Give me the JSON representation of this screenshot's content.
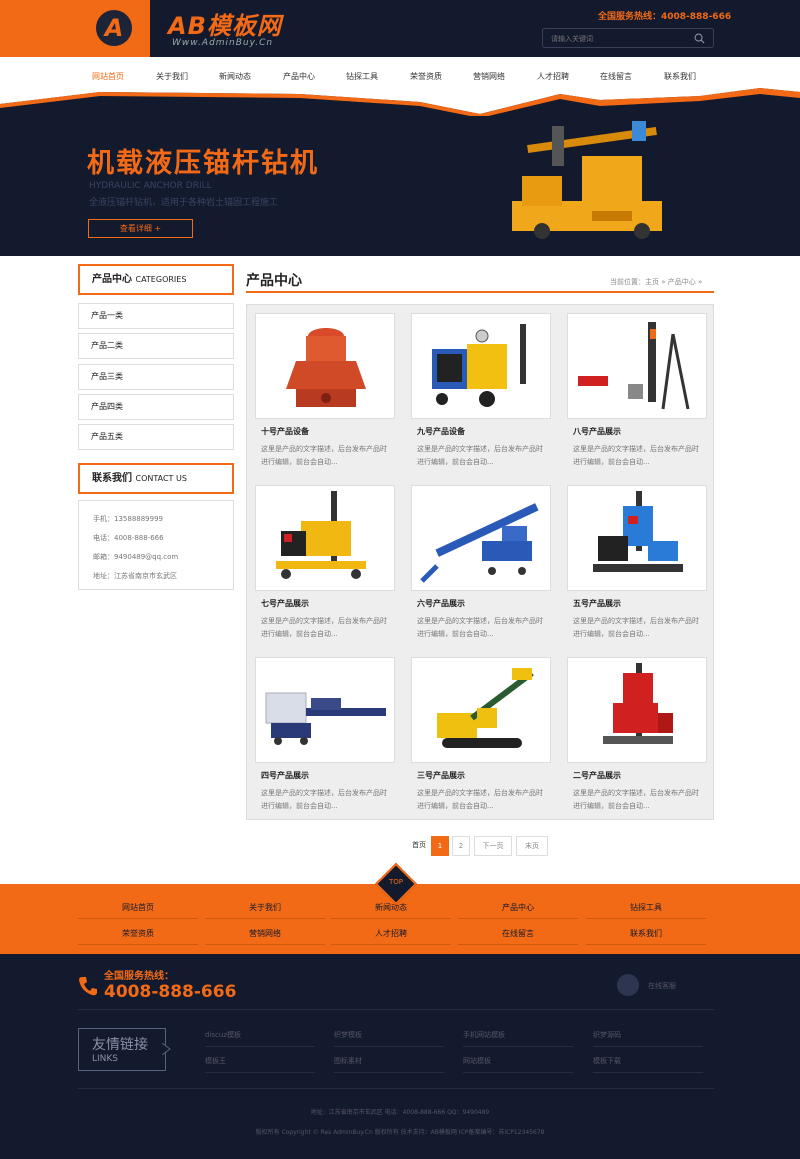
{
  "header": {
    "logo_letter": "A",
    "logo_text": "AB模板网",
    "logo_sub": "Www.AdminBuy.Cn",
    "hotline": "全国服务热线：4008-888-666",
    "search_placeholder": "请输入关键词"
  },
  "nav": {
    "items": [
      "网站首页",
      "关于我们",
      "新闻动态",
      "产品中心",
      "钻探工具",
      "荣誉资质",
      "营销网络",
      "人才招聘",
      "在线留言",
      "联系我们"
    ],
    "active_index": 0
  },
  "banner": {
    "title": "机载液压锚杆钻机",
    "sub1": "HYDRAULIC ANCHOR DRILL",
    "sub2": "全液压锚杆钻机，适用于各种岩土锚固工程施工",
    "button": "查看详细 +"
  },
  "sidebar": {
    "products_head": "产品中心",
    "products_head_en": "CATEGORIES",
    "categories": [
      "产品一类",
      "产品二类",
      "产品三类",
      "产品四类",
      "产品五类"
    ],
    "contact_head": "联系我们",
    "contact_head_en": "CONTACT US",
    "contact": {
      "mobile": "手机：13588889999",
      "phone": "电话：4008-888-666",
      "email": "邮箱：9490489@qq.com",
      "address": "地址：江苏省南京市玄武区"
    }
  },
  "main": {
    "title": "产品中心",
    "breadcrumb": "当前位置：主页 » 产品中心 »",
    "products": [
      {
        "title": "十号产品设备",
        "desc": "这里是产品的文字描述，后台发布产品时进行编辑，前台会自动...",
        "icon": "cone-crusher"
      },
      {
        "title": "九号产品设备",
        "desc": "这里是产品的文字描述，后台发布产品时进行编辑，前台会自动...",
        "icon": "hydraulic-power-unit"
      },
      {
        "title": "八号产品展示",
        "desc": "这里是产品的文字描述，后台发布产品时进行编辑，前台会自动...",
        "icon": "rock-drill-tripod"
      },
      {
        "title": "七号产品展示",
        "desc": "这里是产品的文字描述，后台发布产品时进行编辑，前台会自动...",
        "icon": "core-drill-rig-yellow"
      },
      {
        "title": "六号产品展示",
        "desc": "这里是产品的文字描述，后台发布产品时进行编辑，前台会自动...",
        "icon": "anchor-drill-blue"
      },
      {
        "title": "五号产品展示",
        "desc": "这里是产品的文字描述，后台发布产品时进行编辑，前台会自动...",
        "icon": "core-drill-rig-blue"
      },
      {
        "title": "四号产品展示",
        "desc": "这里是产品的文字描述，后台发布产品时进行编辑，前台会自动...",
        "icon": "horizontal-drill"
      },
      {
        "title": "三号产品展示",
        "desc": "这里是产品的文字描述，后台发布产品时进行编辑，前台会自动...",
        "icon": "crawler-drill-yellow"
      },
      {
        "title": "二号产品展示",
        "desc": "这里是产品的文字描述，后台发布产品时进行编辑，前台会自动...",
        "icon": "core-drill-rig-red"
      }
    ]
  },
  "pager": {
    "first": "首页",
    "pages": [
      "1",
      "2"
    ],
    "current": "1",
    "next": "下一页",
    "last": "末页"
  },
  "footer_nav": {
    "top_label": "TOP",
    "items": [
      "网站首页",
      "关于我们",
      "新闻动态",
      "产品中心",
      "钻探工具",
      "荣誉资质",
      "营销网络",
      "人才招聘",
      "在线留言",
      "联系我们"
    ]
  },
  "bottom": {
    "hotline_label": "全国服务热线：",
    "hotline_number": "4008-888-666",
    "wechat_label": "在线客服",
    "links_cn": "友情链接",
    "links_en": "LINKS",
    "links": [
      "discuz模板",
      "织梦模板",
      "手机网站模板",
      "织梦源码",
      "模板王",
      "图标素材",
      "网站模板",
      "模板下载"
    ],
    "address_line": "地址：江苏省南京市玄武区    电话：4008-888-666    QQ：9490489",
    "copyright_line": "版权所有 Copyright © Res AdminBuy.Cn 版权所有    技术支持：AB模板网    ICP备案编号：苏ICP12345678"
  },
  "colors": {
    "accent": "#f26a16",
    "dark": "#141a2e"
  }
}
